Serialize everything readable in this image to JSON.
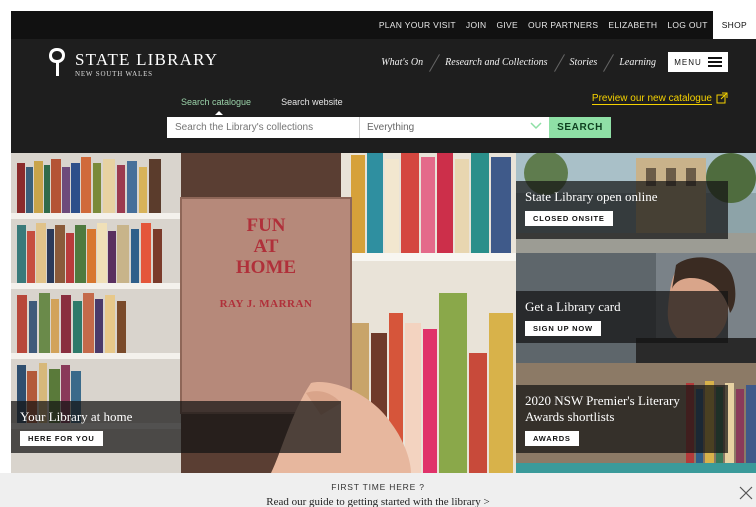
{
  "topnav": {
    "items": [
      "PLAN YOUR VISIT",
      "JOIN",
      "GIVE",
      "OUR PARTNERS",
      "ELIZABETH",
      "LOG OUT"
    ],
    "shop": "SHOP"
  },
  "logo": {
    "title": "STATE LIBRARY",
    "subtitle": "NEW SOUTH WALES"
  },
  "mainnav": {
    "items": [
      "What's On",
      "Research and Collections",
      "Stories",
      "Learning"
    ],
    "menu": "MENU"
  },
  "search": {
    "tabs": [
      "Search catalogue",
      "Search website"
    ],
    "placeholder": "Search the Library's collections",
    "scope": "Everything",
    "button": "SEARCH",
    "preview_link": "Preview our new catalogue"
  },
  "hero": {
    "book_lines": [
      "FUN",
      "AT",
      "HOME"
    ],
    "book_author": "RAY J. MARRAN",
    "title": "Your Library at home",
    "button": "HERE FOR YOU"
  },
  "features": [
    {
      "title": "State Library open online",
      "button": "CLOSED ONSITE"
    },
    {
      "title": "Get a Library card",
      "button": "SIGN UP NOW"
    },
    {
      "title": "2020 NSW Premier's Literary Awards shortlists",
      "button": "AWARDS"
    }
  ],
  "banner": {
    "heading": "FIRST TIME HERE ?",
    "link": "Read our guide to getting started with the library >"
  },
  "colors": {
    "accent_green": "#8fe0a6",
    "accent_yellow": "#f5d200",
    "header_bg": "#1e1e1e"
  }
}
